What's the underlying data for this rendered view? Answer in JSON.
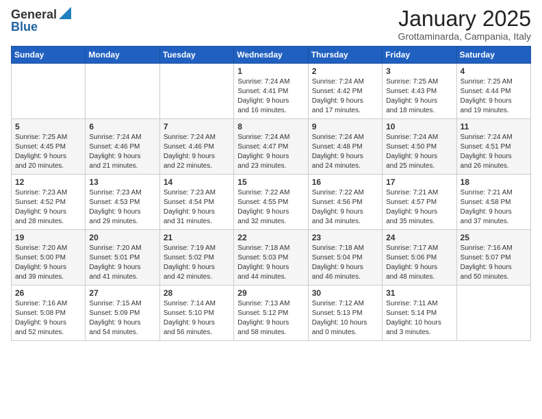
{
  "logo": {
    "general": "General",
    "blue": "Blue"
  },
  "title": "January 2025",
  "location": "Grottaminarda, Campania, Italy",
  "headers": [
    "Sunday",
    "Monday",
    "Tuesday",
    "Wednesday",
    "Thursday",
    "Friday",
    "Saturday"
  ],
  "weeks": [
    [
      {
        "day": "",
        "info": ""
      },
      {
        "day": "",
        "info": ""
      },
      {
        "day": "",
        "info": ""
      },
      {
        "day": "1",
        "info": "Sunrise: 7:24 AM\nSunset: 4:41 PM\nDaylight: 9 hours\nand 16 minutes."
      },
      {
        "day": "2",
        "info": "Sunrise: 7:24 AM\nSunset: 4:42 PM\nDaylight: 9 hours\nand 17 minutes."
      },
      {
        "day": "3",
        "info": "Sunrise: 7:25 AM\nSunset: 4:43 PM\nDaylight: 9 hours\nand 18 minutes."
      },
      {
        "day": "4",
        "info": "Sunrise: 7:25 AM\nSunset: 4:44 PM\nDaylight: 9 hours\nand 19 minutes."
      }
    ],
    [
      {
        "day": "5",
        "info": "Sunrise: 7:25 AM\nSunset: 4:45 PM\nDaylight: 9 hours\nand 20 minutes."
      },
      {
        "day": "6",
        "info": "Sunrise: 7:24 AM\nSunset: 4:46 PM\nDaylight: 9 hours\nand 21 minutes."
      },
      {
        "day": "7",
        "info": "Sunrise: 7:24 AM\nSunset: 4:46 PM\nDaylight: 9 hours\nand 22 minutes."
      },
      {
        "day": "8",
        "info": "Sunrise: 7:24 AM\nSunset: 4:47 PM\nDaylight: 9 hours\nand 23 minutes."
      },
      {
        "day": "9",
        "info": "Sunrise: 7:24 AM\nSunset: 4:48 PM\nDaylight: 9 hours\nand 24 minutes."
      },
      {
        "day": "10",
        "info": "Sunrise: 7:24 AM\nSunset: 4:50 PM\nDaylight: 9 hours\nand 25 minutes."
      },
      {
        "day": "11",
        "info": "Sunrise: 7:24 AM\nSunset: 4:51 PM\nDaylight: 9 hours\nand 26 minutes."
      }
    ],
    [
      {
        "day": "12",
        "info": "Sunrise: 7:23 AM\nSunset: 4:52 PM\nDaylight: 9 hours\nand 28 minutes."
      },
      {
        "day": "13",
        "info": "Sunrise: 7:23 AM\nSunset: 4:53 PM\nDaylight: 9 hours\nand 29 minutes."
      },
      {
        "day": "14",
        "info": "Sunrise: 7:23 AM\nSunset: 4:54 PM\nDaylight: 9 hours\nand 31 minutes."
      },
      {
        "day": "15",
        "info": "Sunrise: 7:22 AM\nSunset: 4:55 PM\nDaylight: 9 hours\nand 32 minutes."
      },
      {
        "day": "16",
        "info": "Sunrise: 7:22 AM\nSunset: 4:56 PM\nDaylight: 9 hours\nand 34 minutes."
      },
      {
        "day": "17",
        "info": "Sunrise: 7:21 AM\nSunset: 4:57 PM\nDaylight: 9 hours\nand 35 minutes."
      },
      {
        "day": "18",
        "info": "Sunrise: 7:21 AM\nSunset: 4:58 PM\nDaylight: 9 hours\nand 37 minutes."
      }
    ],
    [
      {
        "day": "19",
        "info": "Sunrise: 7:20 AM\nSunset: 5:00 PM\nDaylight: 9 hours\nand 39 minutes."
      },
      {
        "day": "20",
        "info": "Sunrise: 7:20 AM\nSunset: 5:01 PM\nDaylight: 9 hours\nand 41 minutes."
      },
      {
        "day": "21",
        "info": "Sunrise: 7:19 AM\nSunset: 5:02 PM\nDaylight: 9 hours\nand 42 minutes."
      },
      {
        "day": "22",
        "info": "Sunrise: 7:18 AM\nSunset: 5:03 PM\nDaylight: 9 hours\nand 44 minutes."
      },
      {
        "day": "23",
        "info": "Sunrise: 7:18 AM\nSunset: 5:04 PM\nDaylight: 9 hours\nand 46 minutes."
      },
      {
        "day": "24",
        "info": "Sunrise: 7:17 AM\nSunset: 5:06 PM\nDaylight: 9 hours\nand 48 minutes."
      },
      {
        "day": "25",
        "info": "Sunrise: 7:16 AM\nSunset: 5:07 PM\nDaylight: 9 hours\nand 50 minutes."
      }
    ],
    [
      {
        "day": "26",
        "info": "Sunrise: 7:16 AM\nSunset: 5:08 PM\nDaylight: 9 hours\nand 52 minutes."
      },
      {
        "day": "27",
        "info": "Sunrise: 7:15 AM\nSunset: 5:09 PM\nDaylight: 9 hours\nand 54 minutes."
      },
      {
        "day": "28",
        "info": "Sunrise: 7:14 AM\nSunset: 5:10 PM\nDaylight: 9 hours\nand 56 minutes."
      },
      {
        "day": "29",
        "info": "Sunrise: 7:13 AM\nSunset: 5:12 PM\nDaylight: 9 hours\nand 58 minutes."
      },
      {
        "day": "30",
        "info": "Sunrise: 7:12 AM\nSunset: 5:13 PM\nDaylight: 10 hours\nand 0 minutes."
      },
      {
        "day": "31",
        "info": "Sunrise: 7:11 AM\nSunset: 5:14 PM\nDaylight: 10 hours\nand 3 minutes."
      },
      {
        "day": "",
        "info": ""
      }
    ]
  ]
}
